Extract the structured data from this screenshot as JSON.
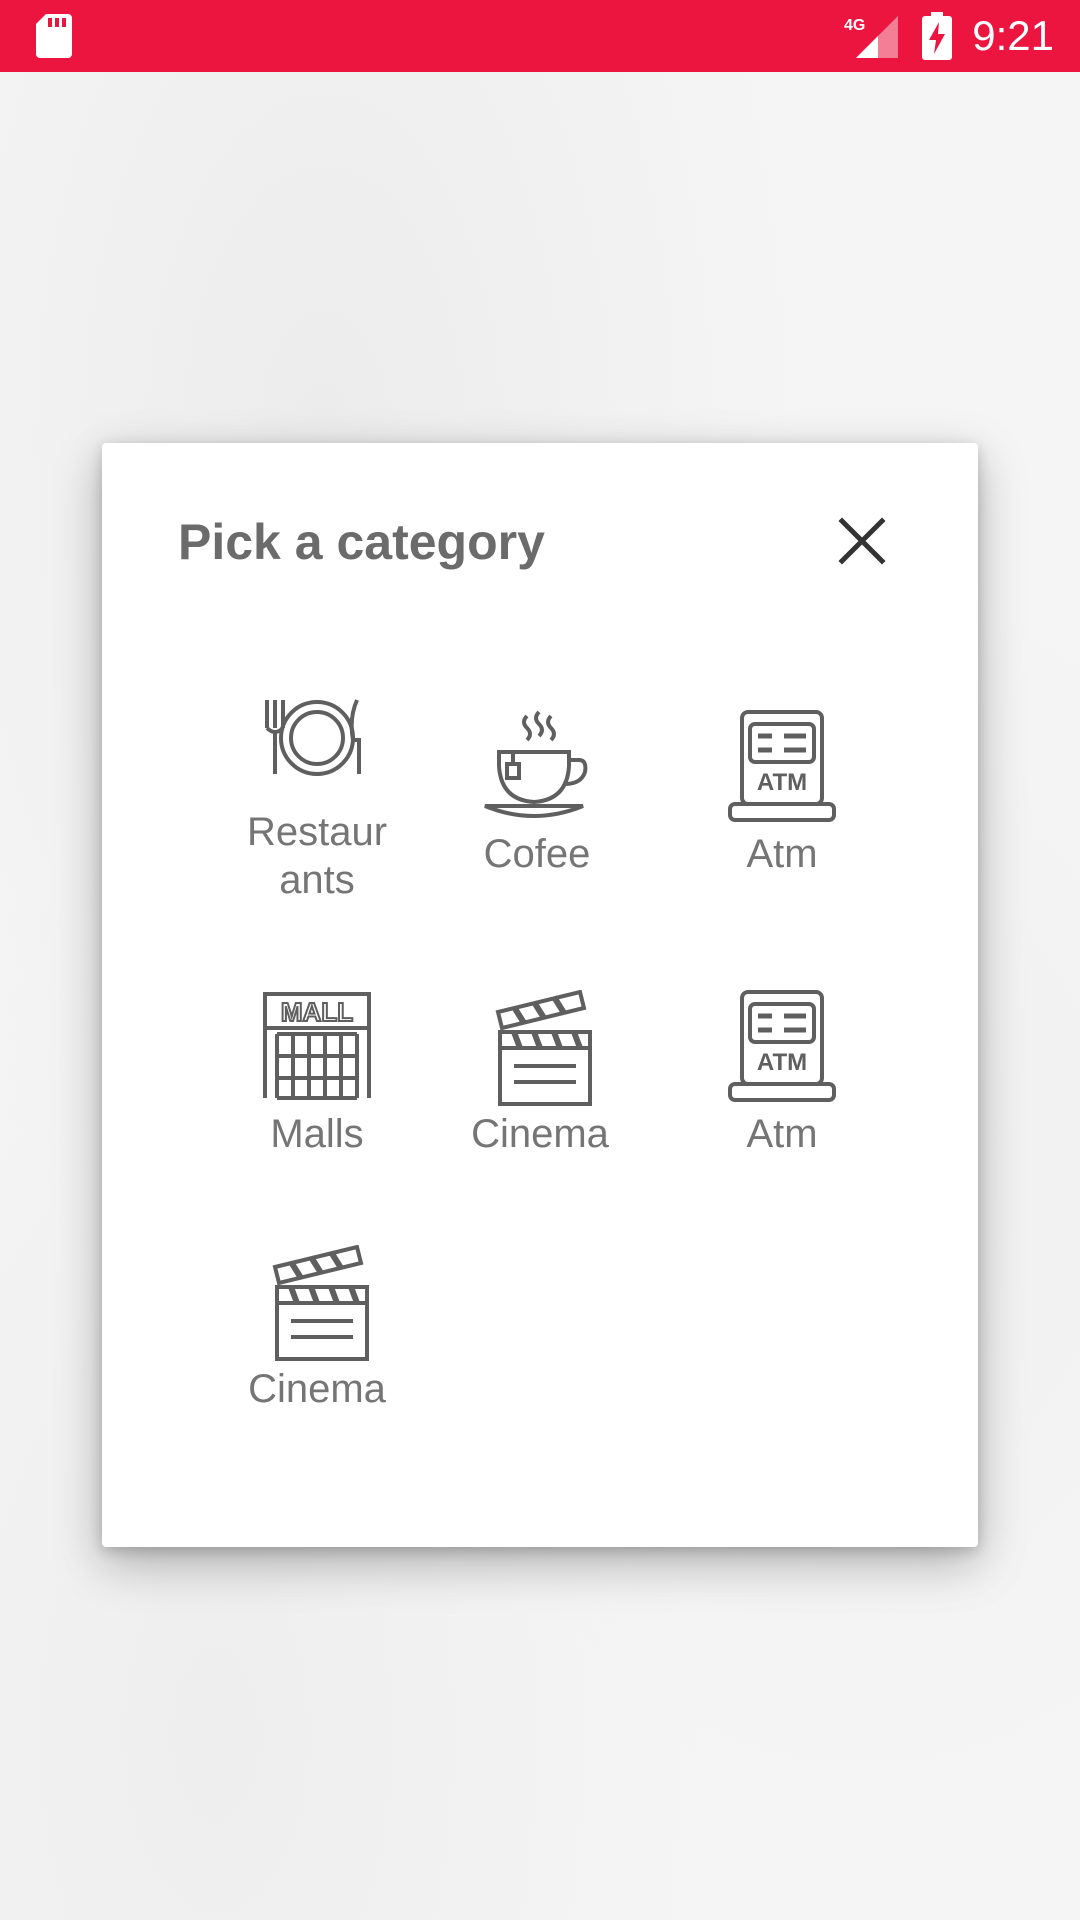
{
  "status_bar": {
    "time": "9:21",
    "network": "4G",
    "background_color": "#ec1540",
    "icons": [
      "sd-card-icon",
      "signal-icon",
      "battery-charging-icon"
    ]
  },
  "dialog": {
    "title": "Pick a category",
    "close_icon": "close-icon",
    "categories": [
      {
        "label": "Restaur ants",
        "icon": "restaurant-icon"
      },
      {
        "label": "Cofee",
        "icon": "coffee-cup-icon"
      },
      {
        "label": "Atm",
        "icon": "atm-icon"
      },
      {
        "label": "Malls",
        "icon": "mall-icon"
      },
      {
        "label": "Cinema",
        "icon": "clapperboard-icon"
      },
      {
        "label": "Atm",
        "icon": "atm-icon"
      },
      {
        "label": "Cinema",
        "icon": "clapperboard-icon"
      }
    ]
  },
  "colors": {
    "accent": "#ec1540",
    "icon_gray": "#5f5f5f",
    "label_gray": "#757575",
    "title_gray": "#6b6b6b"
  }
}
